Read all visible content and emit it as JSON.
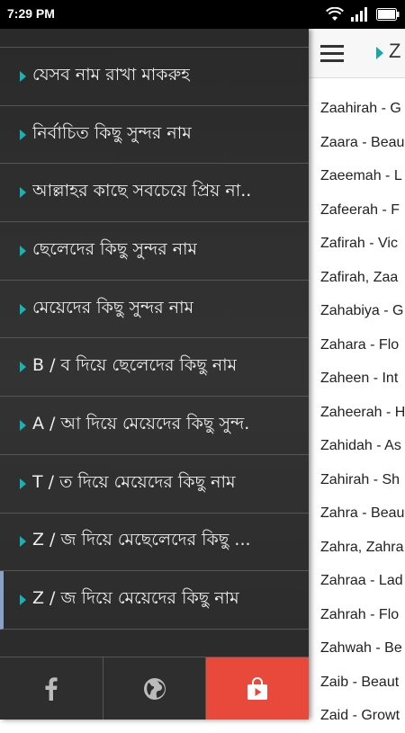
{
  "status_bar": {
    "time": "7:29 PM",
    "icons": [
      "wifi-icon",
      "signal-icon",
      "battery-icon"
    ]
  },
  "app_bar": {
    "title": "Z",
    "menu_icon": "hamburger-icon"
  },
  "drawer": {
    "items": [
      {
        "label": "যেসব নাম রাখা মাকরুহ"
      },
      {
        "label": "নির্বাচিত কিছু সুন্দর নাম"
      },
      {
        "label": "আল্লাহর কাছে সবচেয়ে প্রিয় না.."
      },
      {
        "label": "ছেলেদের কিছু সুন্দর নাম"
      },
      {
        "label": "মেয়েদের কিছু সুন্দর নাম"
      },
      {
        "label": "B / ব দিয়ে ছেলেদের কিছু নাম"
      },
      {
        "label": "A / আ দিয়ে মেয়েদের কিছু সুন্দ."
      },
      {
        "label": "T / ত দিয়ে মেয়েদের কিছু নাম"
      },
      {
        "label": "Z / জ দিয়ে মেছেলেদের কিছু ..."
      },
      {
        "label": "Z / জ দিয়ে মেয়েদের কিছু নাম"
      }
    ],
    "selected_index": 9,
    "bottom_buttons": [
      "facebook-icon",
      "globe-icon",
      "store-icon"
    ],
    "colors": {
      "accent": "#17b3b3",
      "store": "#e8493b",
      "selected_marker": "#8aa2c8"
    }
  },
  "names_list": [
    "Zaahirah - G",
    "Zaara - Beau",
    "Zaeemah - L",
    "Zafeerah - F",
    "Zafirah - Vic",
    "Zafirah, Zaa",
    "Zahabiya - G",
    "Zahara - Flo",
    "Zaheen - Int",
    "Zaheerah - H",
    "Zahidah - As",
    "Zahirah - Sh",
    "Zahra - Beau",
    "Zahra, Zahra",
    "Zahraa - Lad",
    "Zahrah - Flo",
    "Zahwah - Be",
    "Zaib - Beaut",
    "Zaid - Growt"
  ]
}
